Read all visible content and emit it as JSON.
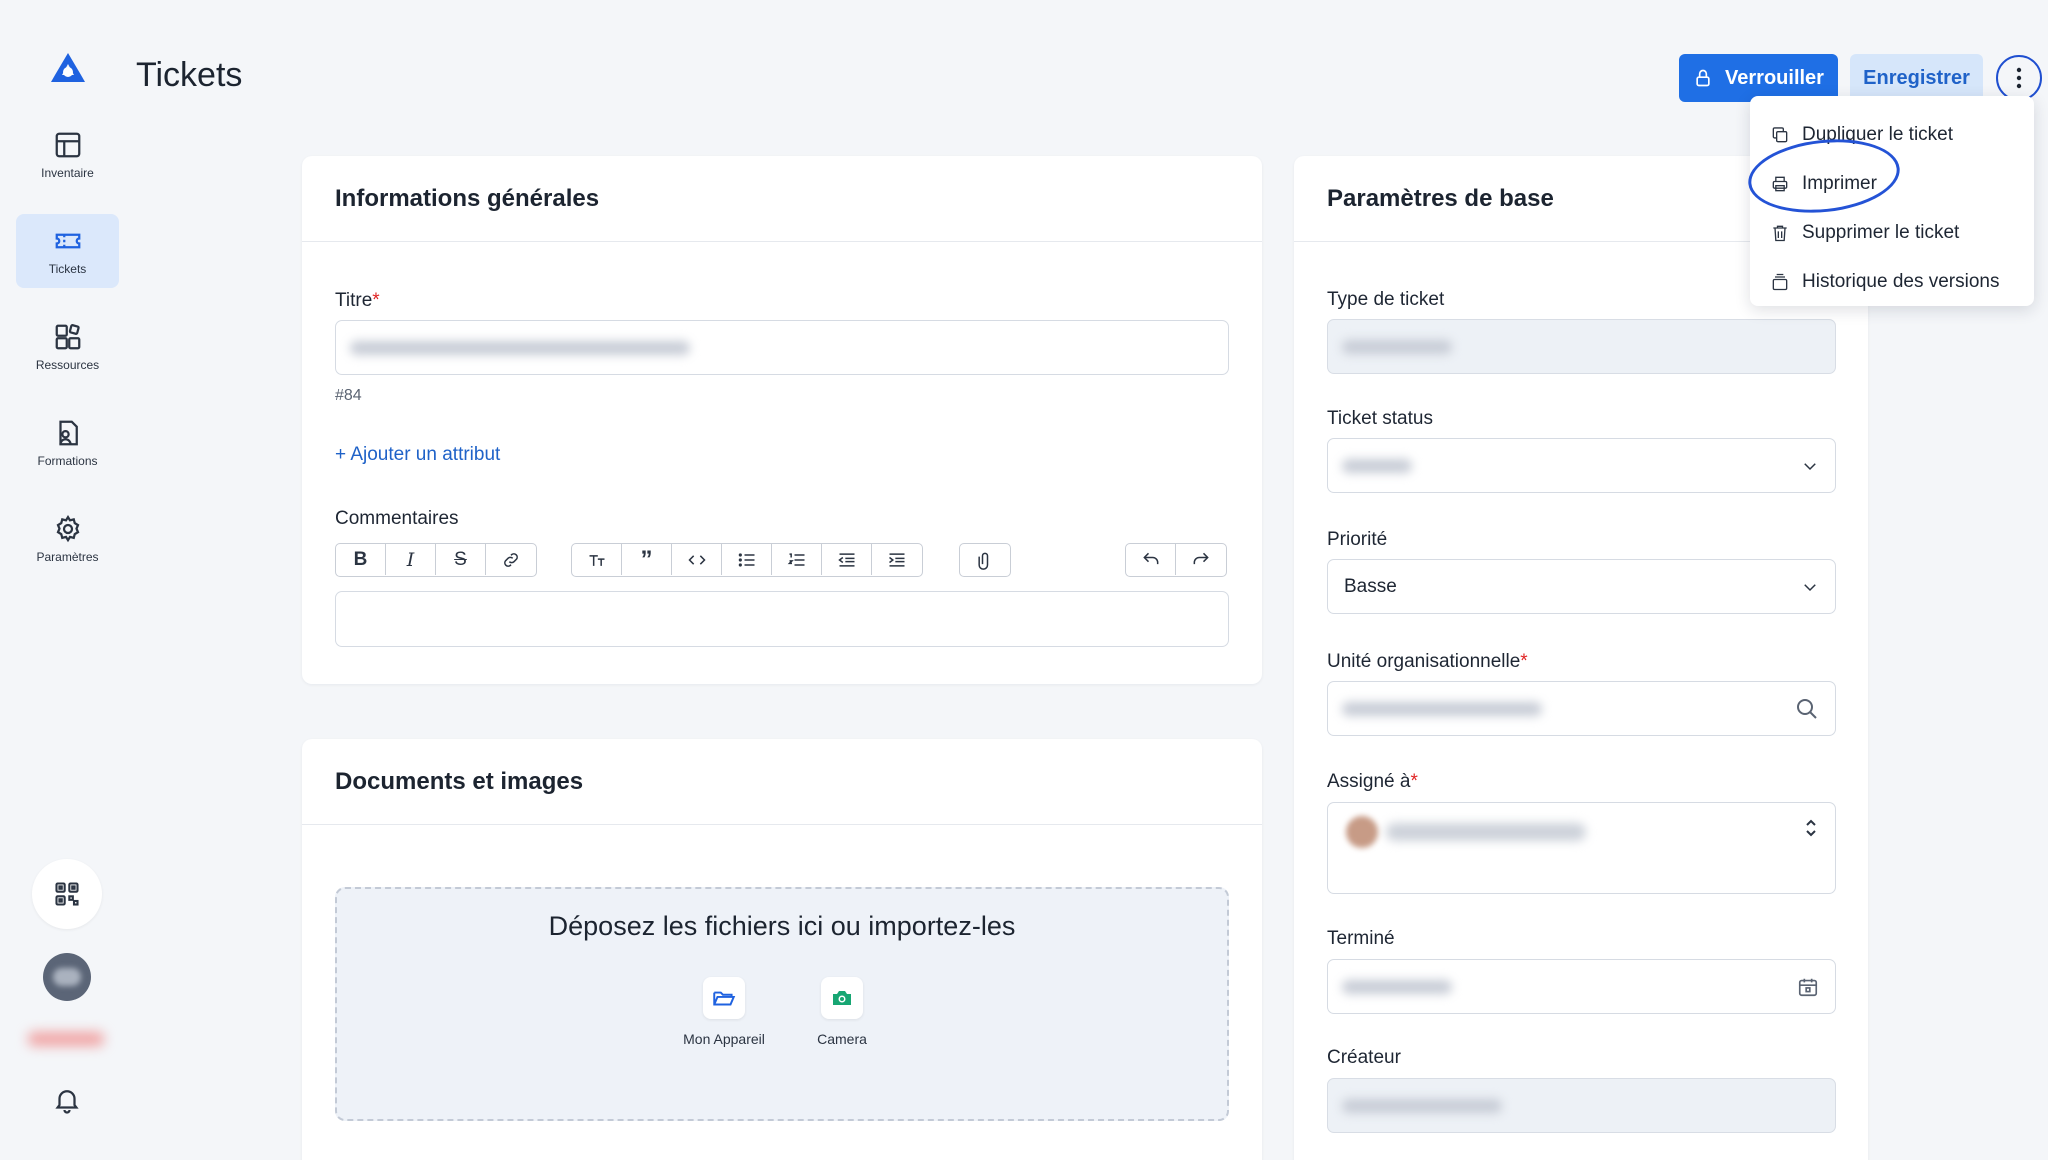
{
  "app": {
    "page_title": "Tickets"
  },
  "sidebar": {
    "items": [
      {
        "label": "Inventaire",
        "icon": "table-icon"
      },
      {
        "label": "Tickets",
        "icon": "ticket-icon"
      },
      {
        "label": "Ressources",
        "icon": "resources-icon"
      },
      {
        "label": "Formations",
        "icon": "document-user-icon"
      },
      {
        "label": "Paramètres",
        "icon": "gear-icon"
      }
    ]
  },
  "header": {
    "lock_label": "Verrouiller",
    "save_label": "Enregistrer"
  },
  "more_menu": {
    "items": [
      {
        "label": "Dupliquer le ticket",
        "icon": "copy-icon"
      },
      {
        "label": "Imprimer",
        "icon": "printer-icon"
      },
      {
        "label": "Supprimer le ticket",
        "icon": "trash-icon"
      },
      {
        "label": "Historique des versions",
        "icon": "archive-icon"
      }
    ]
  },
  "general": {
    "title": "Informations générales",
    "titre_label": "Titre",
    "ticket_number": "#84",
    "add_attribute": "+ Ajouter un attribut",
    "comments_label": "Commentaires"
  },
  "documents": {
    "title": "Documents et images",
    "drop_text": "Déposez les fichiers ici ou importez-les",
    "device_label": "Mon Appareil",
    "camera_label": "Camera"
  },
  "base": {
    "title": "Paramètres de base",
    "type_label": "Type de ticket",
    "status_label": "Ticket status",
    "priority_label": "Priorité",
    "priority_value": "Basse",
    "unit_label": "Unité organisationnelle",
    "assigned_label": "Assigné à",
    "done_label": "Terminé",
    "creator_label": "Créateur"
  },
  "colors": {
    "primary": "#1f6fe5",
    "primary_light": "#d6e6fa",
    "required": "#e02424",
    "sidebar_active": "#dbe8fb",
    "camera_green": "#17a673"
  }
}
